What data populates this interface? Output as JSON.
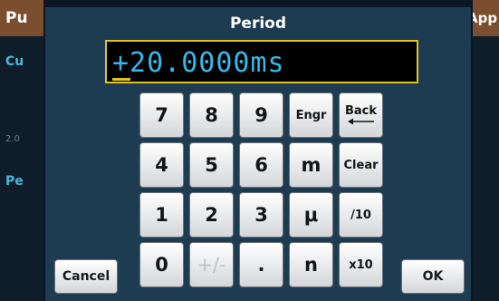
{
  "background": {
    "title_left": "Pu",
    "title_right": "App",
    "label_cu": "Cu",
    "label_pe": "Pe",
    "small_value": "2.0"
  },
  "dialog": {
    "title": "Period",
    "entry_value": "+20.0000ms"
  },
  "keypad": {
    "k7": "7",
    "k8": "8",
    "k9": "9",
    "engr": "Engr",
    "back": "Back",
    "k4": "4",
    "k5": "5",
    "k6": "6",
    "m": "m",
    "clear": "Clear",
    "k1": "1",
    "k2": "2",
    "k3": "3",
    "mu": "μ",
    "div10": "/10",
    "k0": "0",
    "plusminus": "+/-",
    "dot": ".",
    "n": "n",
    "x10": "x10"
  },
  "actions": {
    "cancel": "Cancel",
    "ok": "OK"
  },
  "colors": {
    "title_bar": "#7a4e2e",
    "dialog_bg": "#1d3b51",
    "entry_border": "#e0c327",
    "entry_text": "#39b8e8"
  }
}
